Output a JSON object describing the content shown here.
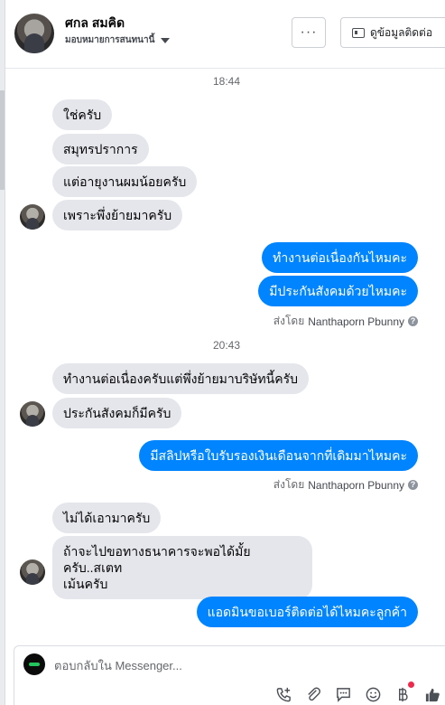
{
  "header": {
    "name": "ศกล สมคิด",
    "status": "มอบหมายการสนทนานี้",
    "more_label": "···",
    "contact_label": "ดูข้อมูลติดต่อ"
  },
  "chat": {
    "time1": "18:44",
    "time2": "20:43",
    "messages": {
      "m1": "ใช่ครับ",
      "m2": "สมุทรปราการ",
      "m3": "แต่อายุงานผมน้อยครับ",
      "m4": "เพราะพึ่งย้ายมาครับ",
      "o1": "ทำงานต่อเนื่องกันไหมคะ",
      "o2": "มีประกันสังคมด้วยไหมคะ",
      "m5": "ทำงานต่อเนื่องครับแต่พึ่งย้ายมาบริษัทนี้ครับ",
      "m6": "ประกันสังคมก็มีครับ",
      "o3": "มีสลิปหรือใบรับรองเงินเดือนจากที่เดิมมาไหมคะ",
      "m7": "ไม่ได้เอามาครับ",
      "m8_line1": "ถ้าจะไปขอทางธนาคารจะพอได้มั้ยครับ..สเตท",
      "m8_line2": "เม้นครับ",
      "o4": "แอดมินขอเบอร์ติดต่อได้ไหมคะลูกค้า"
    },
    "sent_by_prefix": "ส่งโดย",
    "sent_by_name": "Nanthaporn Pbunny",
    "help_icon": "?"
  },
  "composer": {
    "placeholder": "ตอบกลับใน Messenger..."
  },
  "colors": {
    "outgoing": "#0084ff",
    "incoming": "#e4e6eb",
    "notify": "#f02849"
  }
}
